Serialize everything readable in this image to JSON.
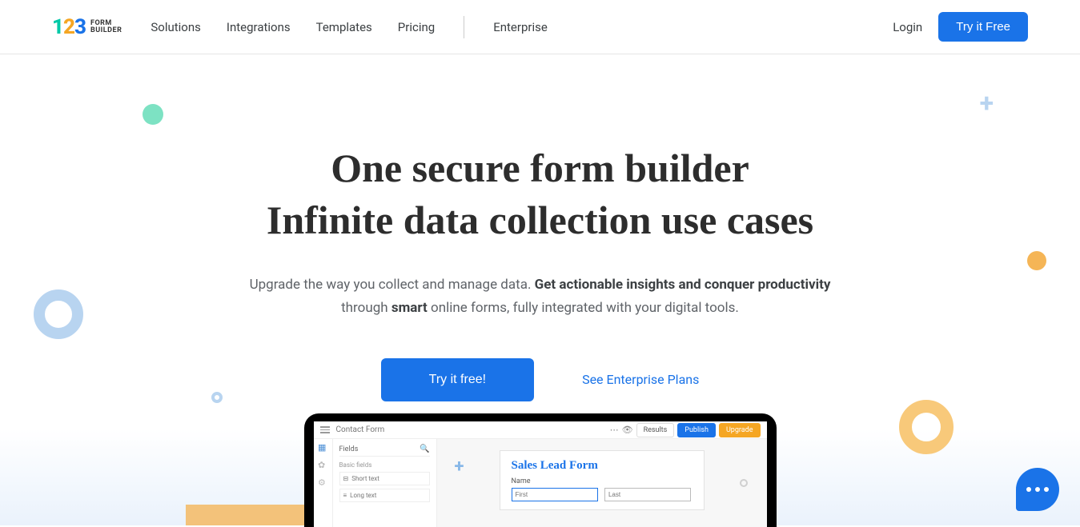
{
  "header": {
    "brand_text": "FORM\nBUILDER",
    "nav": [
      "Solutions",
      "Integrations",
      "Templates",
      "Pricing"
    ],
    "nav_after_divider": "Enterprise",
    "login": "Login",
    "cta": "Try it Free"
  },
  "hero": {
    "title_line1": "One secure form builder",
    "title_line2": "Infinite data collection use cases",
    "sub_pre": "Upgrade the way you collect and manage data. ",
    "sub_bold1": "Get actionable insights and conquer productivity",
    "sub_mid": " through ",
    "sub_bold2": "smart",
    "sub_post": " online forms, fully integrated with your digital tools.",
    "cta_primary": "Try it free!",
    "cta_secondary": "See Enterprise Plans"
  },
  "laptop": {
    "app_title": "Contact Form",
    "results": "Results",
    "publish": "Publish",
    "upgrade": "Upgrade",
    "panel_title": "Fields",
    "panel_sub": "Basic fields",
    "field1": "Short text",
    "field2": "Long text",
    "form_title": "Sales Lead Form",
    "form_label": "Name",
    "first_ph": "First",
    "last_ph": "Last"
  }
}
